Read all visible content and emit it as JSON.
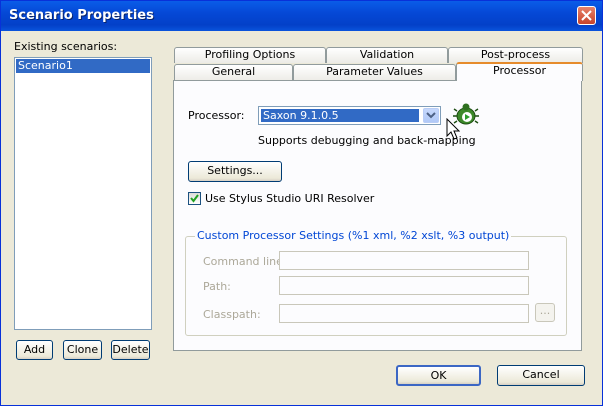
{
  "window": {
    "title": "Scenario Properties"
  },
  "left": {
    "label": "Existing scenarios:",
    "scenarios": [
      "Scenario1"
    ],
    "buttons": {
      "add": "Add",
      "clone": "Clone",
      "delete": "Delete"
    }
  },
  "tabs": {
    "row_back": [
      "Profiling Options",
      "Validation",
      "Post-process"
    ],
    "row_front": [
      "General",
      "Parameter Values",
      "Processor"
    ],
    "active": "Processor"
  },
  "processor": {
    "label": "Processor:",
    "value": "Saxon 9.1.0.5",
    "description": "Supports debugging and back-mapping",
    "settings_button": "Settings...",
    "uri_resolver_label": "Use Stylus Studio URI Resolver",
    "uri_resolver_checked": true
  },
  "custom": {
    "legend": "Custom Processor Settings (%1 xml, %2 xslt, %3 output)",
    "command_line_label": "Command line:",
    "path_label": "Path:",
    "classpath_label": "Classpath:",
    "command_line_value": "",
    "path_value": "",
    "classpath_value": "",
    "browse_label": "..."
  },
  "footer": {
    "ok": "OK",
    "cancel": "Cancel"
  },
  "icons": {
    "close": "close-icon",
    "dropdown": "chevron-down-icon",
    "debug": "bug-debug-icon",
    "cursor": "mouse-pointer-icon"
  }
}
